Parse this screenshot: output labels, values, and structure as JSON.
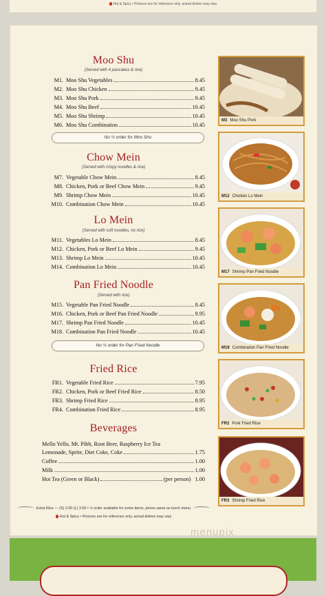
{
  "top_note": "Hot & Spicy • Pictures are for reference only, actual dishes may vary",
  "sections": [
    {
      "title": "Moo Shu",
      "subtitle": "(Served with 4 pancakes & rice)",
      "items": [
        {
          "code": "M1.",
          "name": "Moo Shu Vegetables",
          "price": "8.45"
        },
        {
          "code": "M2.",
          "name": "Moo Shu Chicken",
          "price": "9.45"
        },
        {
          "code": "M3.",
          "name": "Moo Shu Pork",
          "price": "9.45"
        },
        {
          "code": "M4.",
          "name": "Moo Shu Beef",
          "price": "10.45"
        },
        {
          "code": "M5.",
          "name": "Moo Shu Shrimp",
          "price": "10.45"
        },
        {
          "code": "M6.",
          "name": "Moo Shu Combination",
          "price": "10.45"
        }
      ],
      "note": "No ½ order for Moo Shu"
    },
    {
      "title": "Chow Mein",
      "subtitle": "(Served with crispy noodles & rice)",
      "items": [
        {
          "code": "M7.",
          "name": "Vegetable Chow Mein",
          "price": "8.45"
        },
        {
          "code": "M8.",
          "name": "Chicken, Pork or Beef Chow Mein",
          "price": "9.45"
        },
        {
          "code": "M9.",
          "name": "Shrimp Chow Mein",
          "price": "10.45"
        },
        {
          "code": "M10.",
          "name": "Combination Chow Mein",
          "price": "10.45"
        }
      ]
    },
    {
      "title": "Lo Mein",
      "subtitle": "(Served with soft noodles, no rice)",
      "items": [
        {
          "code": "M11.",
          "name": "Vegetables Lo Mein",
          "price": "8.45"
        },
        {
          "code": "M12.",
          "name": "Chicken, Pork or Beef Lo Mein",
          "price": "9.45"
        },
        {
          "code": "M13.",
          "name": "Shrimp Lo Mein",
          "price": "10.45"
        },
        {
          "code": "M14.",
          "name": "Combination Lo Mein",
          "price": "10.45"
        }
      ]
    },
    {
      "title": "Pan Fried Noodle",
      "subtitle": "(Served with rice)",
      "items": [
        {
          "code": "M15.",
          "name": "Vegetable Pan Fried Noodle",
          "price": "8.45"
        },
        {
          "code": "M16.",
          "name": "Chicken, Pork or Beef Pan Fried Noodle",
          "price": "9.95"
        },
        {
          "code": "M17.",
          "name": "Shrimp Pan Fried Noodle",
          "price": "10.45"
        },
        {
          "code": "M18.",
          "name": "Combination Pan Fried Noodle",
          "price": "10.45"
        }
      ],
      "note": "No ½ order for Pan Fried Noodle"
    },
    {
      "title": "Fried Rice",
      "items": [
        {
          "code": "FR1.",
          "name": "Vegetable Fried Rice",
          "price": "7.95"
        },
        {
          "code": "FR2.",
          "name": "Chicken, Pork or Beef Fried Rice",
          "price": "8.50"
        },
        {
          "code": "FR3.",
          "name": "Shrimp Fried Rice",
          "price": "8.95"
        },
        {
          "code": "FR4.",
          "name": "Combination Fried Rice",
          "price": "8.95"
        }
      ]
    }
  ],
  "beverages": {
    "title": "Beverages",
    "line1": "Mello Yello, Mt. Pibb, Root Beer, Raspberry Ice Tea",
    "items": [
      {
        "name": "Lemonade, Sprite, Diet Coke, Coke",
        "price": "1.75"
      },
      {
        "name": "Coffee",
        "price": "1.00"
      },
      {
        "name": "Milk",
        "price": "1.00"
      },
      {
        "name": "Hot Tea (Green or Black)",
        "suffix": "(per person)",
        "price": "1.00"
      }
    ]
  },
  "footer_note1": "Extra Rice — (S) 2.00 (L) 3.00 • ½ order available for some items, prices same as lunch menu",
  "footer_note2": "Hot & Spicy • Pictures are for reference only, actual dishes may vary",
  "photos": [
    {
      "code": "M3",
      "label": "Moo Shu Pork"
    },
    {
      "code": "M12",
      "label": "Chicken Lo Mein"
    },
    {
      "code": "M17",
      "label": "Shrimp Pan Fried Noodle"
    },
    {
      "code": "M18",
      "label": "Combination Pan Fried Noodle"
    },
    {
      "code": "FR2",
      "label": "Pork Fried Rice"
    },
    {
      "code": "FR3",
      "label": "Shrimp Fried Rice"
    }
  ],
  "watermark": "menupix",
  "colors": {
    "title": "#a21d22",
    "frame": "#d39a3e",
    "green_band": "#79b443"
  }
}
